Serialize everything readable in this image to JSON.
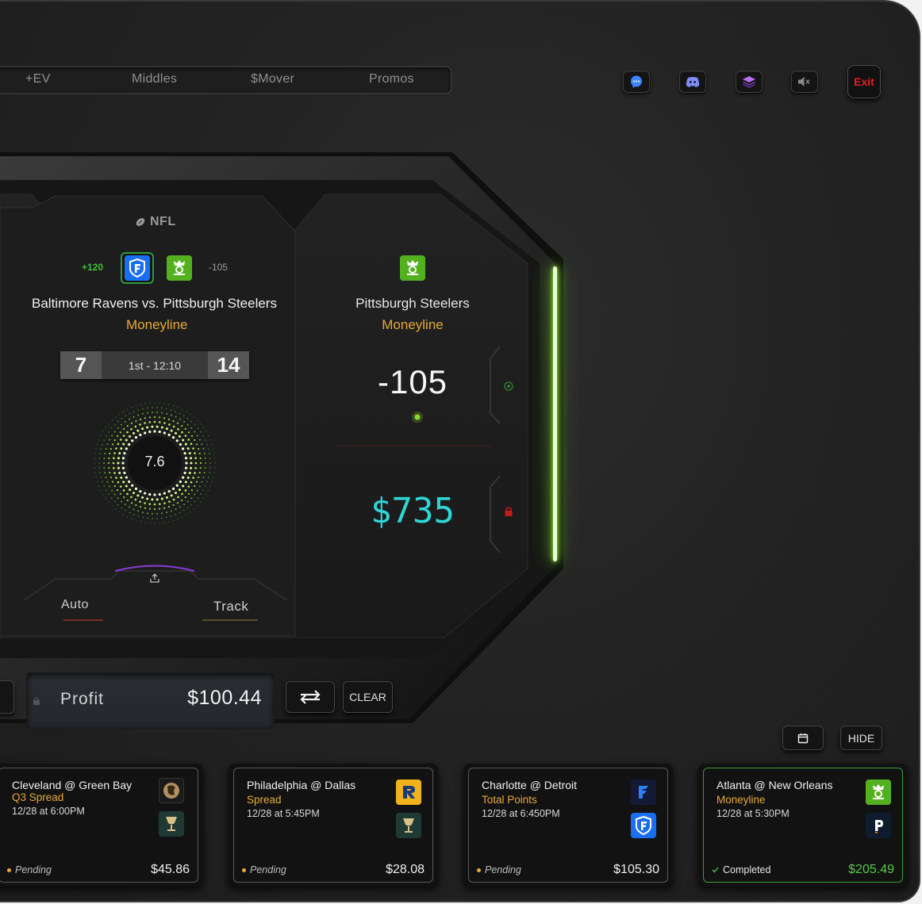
{
  "nav": {
    "tabs": [
      "+EV",
      "Middles",
      "$Mover",
      "Promos"
    ]
  },
  "toolbar": {
    "icons": [
      "chat-icon",
      "discord-icon",
      "layers-icon",
      "mute-icon"
    ],
    "exit_label": "Exit"
  },
  "game_panel": {
    "league": "NFL",
    "left_odds": "+120",
    "right_odds": "-105",
    "matchup": "Baltimore Ravens vs. Pittsburgh Steelers",
    "bet_type": "Moneyline",
    "score_home": "7",
    "clock": "1st - 12:10",
    "score_away": "14",
    "dial_value": "7.6",
    "auto_label": "Auto",
    "track_label": "Track"
  },
  "selection_panel": {
    "team": "Pittsburgh Steelers",
    "bet_type": "Moneyline",
    "odds": "-105",
    "stake": "$735"
  },
  "profit": {
    "label": "Profit",
    "value": "$100.44",
    "clear_label": "CLEAR"
  },
  "history": {
    "hide_label": "HIDE",
    "cards": [
      {
        "matchup": "Cleveland @ Green Bay",
        "type": "Q3 Spread",
        "date": "12/28 at 6:00PM",
        "status": "Pending",
        "amount": "$45.86"
      },
      {
        "matchup": "Philadelphia @ Dallas",
        "type": "Spread",
        "date": "12/28 at 5:45PM",
        "status": "Pending",
        "amount": "$28.08"
      },
      {
        "matchup": "Charlotte @ Detroit",
        "type": "Total Points",
        "date": "12/28 at 6:450PM",
        "status": "Pending",
        "amount": "$105.30"
      },
      {
        "matchup": "Atlanta @ New Orleans",
        "type": "Moneyline",
        "date": "12/28 at 5:30PM",
        "status": "Completed",
        "amount": "$205.49"
      }
    ]
  },
  "colors": {
    "accent_green": "#7ddc2a",
    "odds_green": "#3ec23e",
    "bet_type_gold": "#e7a93a",
    "stake_cyan": "#2ed6d6",
    "exit_red": "#e61e1e",
    "fanduel_blue": "#1a6ff0",
    "draftkings_green": "#53b11f"
  }
}
